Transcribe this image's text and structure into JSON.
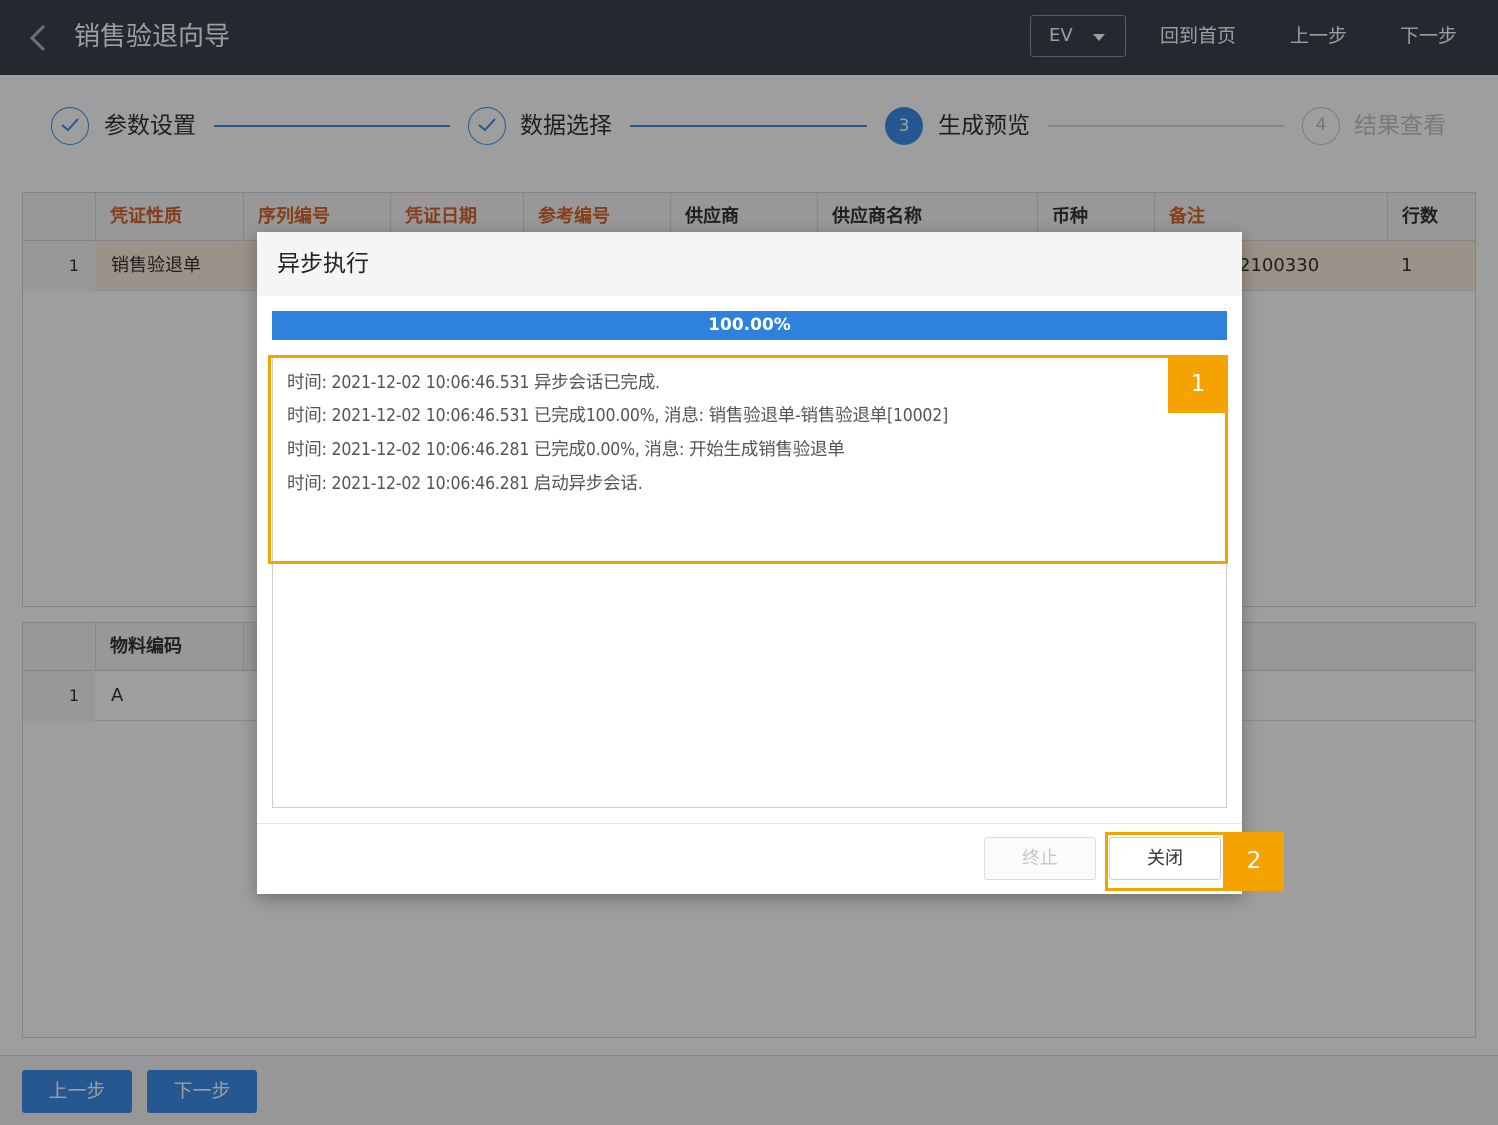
{
  "header": {
    "title": "销售验退向导",
    "env_select": "EV",
    "links": [
      "回到首页",
      "上一步",
      "下一步"
    ]
  },
  "steps": [
    {
      "label": "参数设置",
      "state": "done"
    },
    {
      "label": "数据选择",
      "state": "done"
    },
    {
      "label": "生成预览",
      "state": "active",
      "number": "3"
    },
    {
      "label": "结果查看",
      "state": "todo",
      "number": "4"
    }
  ],
  "main_grid": {
    "columns": [
      "凭证性质",
      "序列编号",
      "凭证日期",
      "参考编号",
      "供应商",
      "供应商名称",
      "币种",
      "备注",
      "行数"
    ],
    "rows": [
      {
        "no": "1",
        "doc_type": "销售验退单",
        "remark_partial": "2100330",
        "line_count": "1"
      }
    ]
  },
  "detail_grid": {
    "columns": [
      "物料编码"
    ],
    "rows": [
      {
        "no": "1",
        "material_code": "A"
      }
    ]
  },
  "footer": {
    "prev_label": "上一步",
    "next_label": "下一步"
  },
  "modal": {
    "title": "异步执行",
    "progress_text": "100.00%",
    "progress_value": 1.0,
    "log_lines": [
      "时间: 2021-12-02 10:06:46.531 异步会话已完成.",
      "时间: 2021-12-02 10:06:46.531 已完成100.00%, 消息: 销售验退单-销售验退单[10002]",
      "时间: 2021-12-02 10:06:46.281 已完成0.00%, 消息: 开始生成销售验退单",
      "时间: 2021-12-02 10:06:46.281 启动异步会话."
    ],
    "stop_label": "终止",
    "close_label": "关闭"
  },
  "callouts": [
    "1",
    "2"
  ],
  "colors": {
    "topbar": "#3a434d",
    "accent": "#3d8ee8",
    "required_header": "#d9632b",
    "highlight": "#f5a300",
    "selected_row": "#fbeedd"
  }
}
